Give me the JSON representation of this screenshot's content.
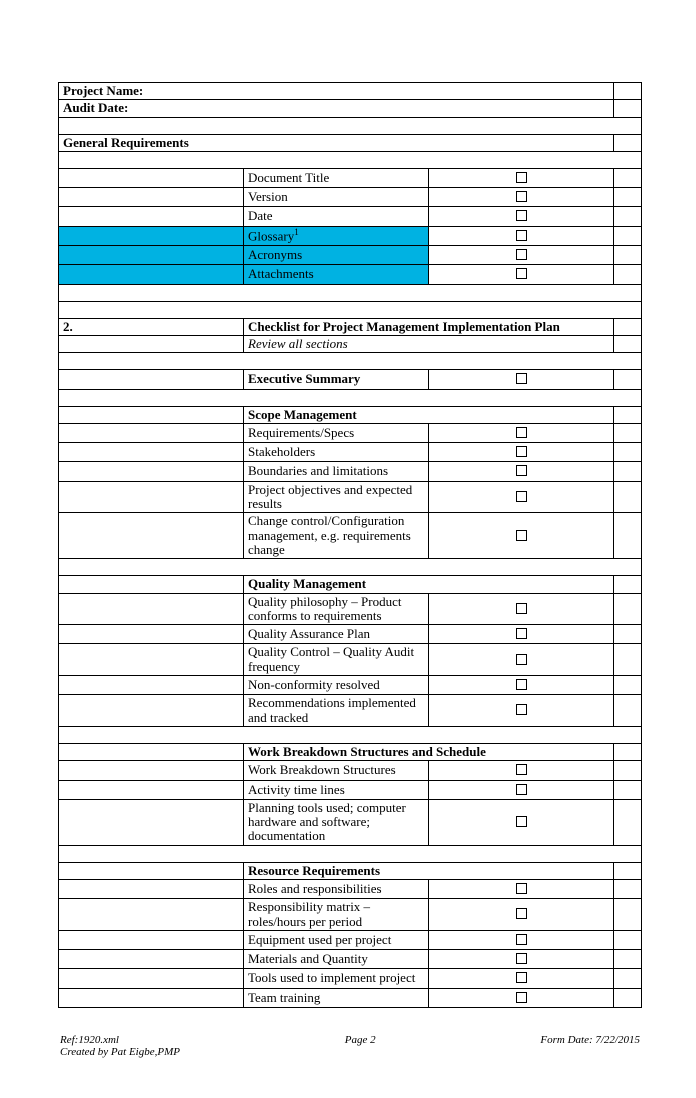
{
  "header": {
    "project_name_label": "Project Name:",
    "audit_date_label": "Audit Date:"
  },
  "general": {
    "title": "General Requirements",
    "items": [
      {
        "label": "Document Title",
        "hl": false
      },
      {
        "label": "Version",
        "hl": false
      },
      {
        "label": "Date",
        "hl": false
      },
      {
        "label_html": "Glossary",
        "sup": "1",
        "hl": true
      },
      {
        "label": "Acronyms",
        "hl": true
      },
      {
        "label": "Attachments",
        "hl": true
      }
    ]
  },
  "section2": {
    "num": "2.",
    "title": "Checklist for Project Management Implementation Plan",
    "subtitle": "Review all sections",
    "exec_summary": "Executive Summary"
  },
  "scope": {
    "title": "Scope Management",
    "items": [
      "Requirements/Specs",
      "Stakeholders",
      "Boundaries and limitations",
      "Project objectives and expected results",
      "Change control/Configuration management, e.g. requirements change"
    ]
  },
  "quality": {
    "title": "Quality Management",
    "items": [
      "Quality philosophy – Product conforms to requirements",
      "Quality Assurance Plan",
      "Quality Control – Quality Audit frequency",
      "Non-conformity resolved",
      "Recommendations implemented and tracked"
    ]
  },
  "wbs": {
    "title": "Work Breakdown Structures and Schedule",
    "items": [
      "Work Breakdown Structures",
      "Activity time lines",
      "Planning tools used; computer hardware and software; documentation"
    ]
  },
  "resource": {
    "title": "Resource Requirements",
    "items": [
      "Roles and responsibilities",
      "Responsibility matrix – roles/hours per period",
      "Equipment used per project",
      "Materials and Quantity",
      "Tools used to implement project",
      "Team training"
    ]
  },
  "footer": {
    "ref": "Ref:1920.xml",
    "page": "Page 2",
    "form_date": "Form Date: 7/22/2015",
    "created": "Created by Pat Eigbe,PMP"
  }
}
